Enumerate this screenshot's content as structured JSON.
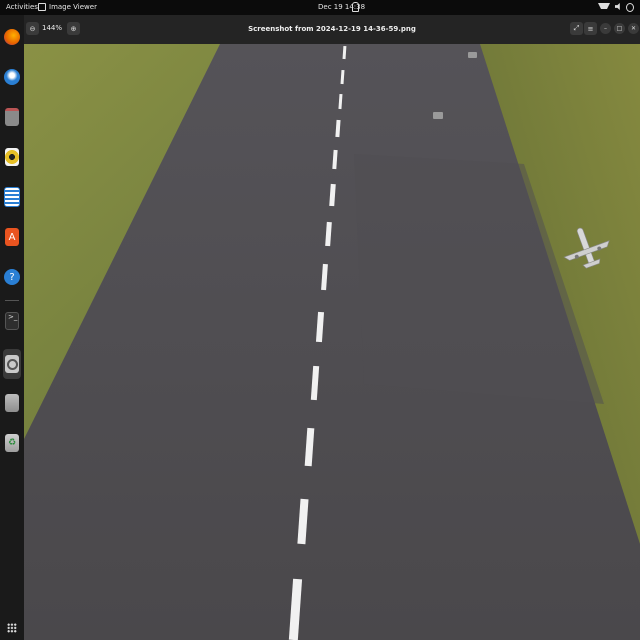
{
  "topbar": {
    "activities": "Activities",
    "app_name": "Image Viewer",
    "clock": "Dec 19  14:38"
  },
  "dock": {
    "items": [
      {
        "name": "firefox-icon",
        "color": "#e66000"
      },
      {
        "name": "thunderbird-icon",
        "color": "#2a7fd4"
      },
      {
        "name": "files-icon",
        "color": "#8a8a8a"
      },
      {
        "name": "rhythmbox-icon",
        "color": "#e7c027"
      },
      {
        "name": "writer-icon",
        "color": "#2a7fd4"
      },
      {
        "name": "app-center-icon",
        "color": "#e95420"
      },
      {
        "name": "help-icon",
        "color": "#2a7fd4"
      },
      {
        "name": "terminal-icon",
        "color": "#2e2e2e"
      },
      {
        "name": "image-viewer-icon",
        "color": "#c9c9c9"
      },
      {
        "name": "drive-icon",
        "color": "#9e9e9e"
      },
      {
        "name": "trash-icon",
        "color": "#9e9e9e"
      }
    ]
  },
  "header": {
    "zoom_level": "144%",
    "title": "Screenshot from 2024-12-19 14-36-59.png"
  },
  "image": {
    "description_colors": {
      "grass": "#6d7a3c",
      "asphalt": "#4b494b",
      "marking": "#f1f1f1"
    }
  }
}
